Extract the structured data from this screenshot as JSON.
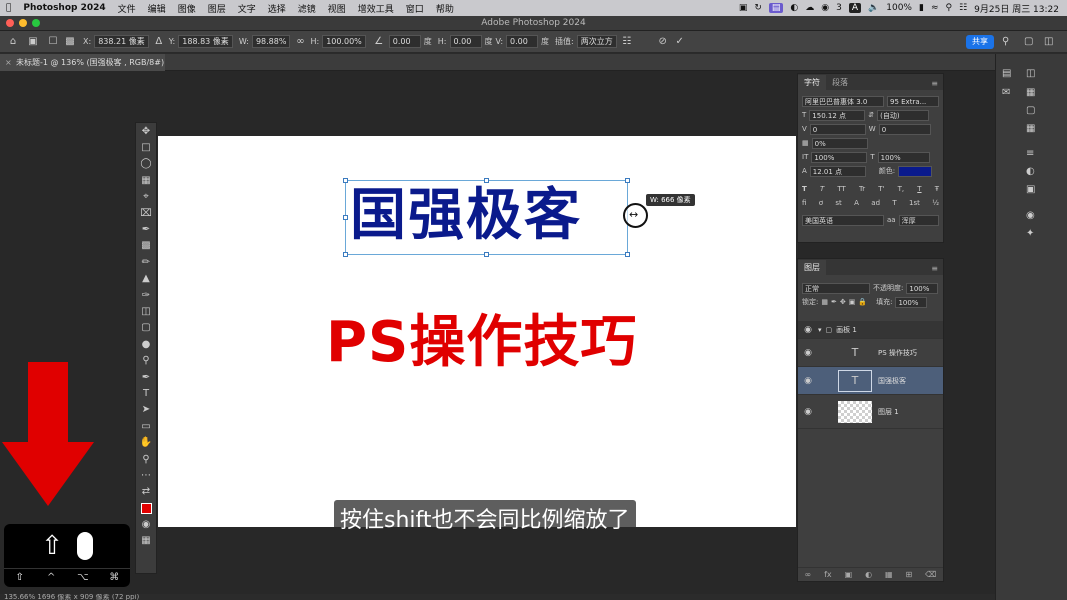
{
  "menubar": {
    "app": "Photoshop 2024",
    "items": [
      "文件",
      "编辑",
      "图像",
      "图层",
      "文字",
      "选择",
      "滤镜",
      "视图",
      "增效工具",
      "窗口",
      "帮助"
    ],
    "status_right": {
      "badge_count": "3",
      "input_label": "A",
      "battery": "100%",
      "datetime": "9月25日 周三  13:22"
    }
  },
  "window": {
    "title": "Adobe Photoshop 2024"
  },
  "options": {
    "x_label": "X:",
    "x_value": "838.21 像素",
    "y_label": "Y:",
    "y_value": "188.83 像素",
    "w_label": "W:",
    "w_value": "98.88%",
    "h_label": "H:",
    "h_value": "100.00%",
    "angle_value": "0.00",
    "angle_unit": "度",
    "hskew_label": "H:",
    "hskew_value": "0.00",
    "hskew_unit": "度",
    "vskew_label": "V:",
    "vskew_value": "0.00",
    "vskew_unit": "度",
    "interp_label": "插值:",
    "interp_value": "两次立方",
    "share_label": "共享"
  },
  "document": {
    "tab": "未标题-1 @ 136% (国强极客 , RGB/8#) *"
  },
  "canvas": {
    "blue_text": "国强极客",
    "red_text": "PS操作技巧",
    "blue_color": "#0a1a8c",
    "red_color": "#e00000",
    "tooltip": "W: 666 像素"
  },
  "subtitle": "按住shift也不会同比例缩放了",
  "keyboard": {
    "keys": [
      "⇧",
      "^",
      "⌥",
      "⌘"
    ]
  },
  "statusbar": "135.66%    1696 像素 x 909 像素 (72 ppi)",
  "character": {
    "tab_active": "字符",
    "tab_other": "段落",
    "font_family": "阿里巴巴普惠体 3.0",
    "font_style": "95 Extra...",
    "size": "150.12 点",
    "leading": "(自动)",
    "kerning": "0",
    "tracking": "0",
    "vscale_pct": "0%",
    "hscale": "100%",
    "vscale": "100%",
    "baseline": "12.01 点",
    "color_label": "颜色:",
    "text_color": "#0a1a8c",
    "language": "美国英语",
    "antialias_label": "aa",
    "antialias": "浑厚",
    "style_buttons": [
      "T",
      "T",
      "TT",
      "Tr",
      "T'",
      "T,",
      "T",
      "Ŧ"
    ],
    "ot_buttons": [
      "fi",
      "ơ",
      "st",
      "A",
      "ad",
      "T",
      "1st",
      "½"
    ]
  },
  "layers": {
    "tab": "图层",
    "blend_mode": "正常",
    "opacity_label": "不透明度:",
    "opacity": "100%",
    "lock_label": "锁定:",
    "fill_label": "填充:",
    "fill": "100%",
    "artboard": "画板 1",
    "items": [
      {
        "name": "PS 操作技巧",
        "kind": "T"
      },
      {
        "name": "国强极客",
        "kind": "T"
      },
      {
        "name": "图层 1",
        "kind": ""
      }
    ]
  }
}
